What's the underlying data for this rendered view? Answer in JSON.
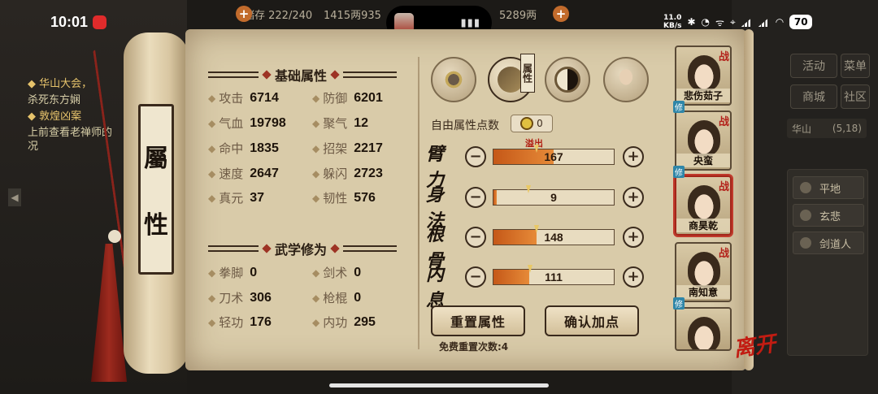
{
  "status_bar": {
    "time": "10:01",
    "net_speed": "11.0\nKB/s",
    "battery": "70"
  },
  "top_resources": {
    "storage": "储存 222/240",
    "silver": "1415两935",
    "gold": "5289两"
  },
  "quests": [
    {
      "text": "◆ 华山大会，",
      "highlight": true
    },
    {
      "text": "杀死东方娴",
      "highlight": false
    },
    {
      "text": "◆ 敦煌凶案",
      "highlight": true
    },
    {
      "text": "上前查看老禅师的",
      "highlight": false
    },
    {
      "text": "况",
      "highlight": false
    }
  ],
  "right_menu": {
    "activity": "活动",
    "menu": "菜单",
    "shop": "商城",
    "community": "社区",
    "location": "华山",
    "coords": "(5,18)"
  },
  "places": [
    "平地",
    "玄悲",
    "剑道人"
  ],
  "rod_title": [
    "屬",
    "性"
  ],
  "basic": {
    "title": "基础属性",
    "attrs": [
      {
        "label": "攻击",
        "value": "6714"
      },
      {
        "label": "防御",
        "value": "6201"
      },
      {
        "label": "气血",
        "value": "19798"
      },
      {
        "label": "聚气",
        "value": "12"
      },
      {
        "label": "命中",
        "value": "1835"
      },
      {
        "label": "招架",
        "value": "2217"
      },
      {
        "label": "速度",
        "value": "2647"
      },
      {
        "label": "躲闪",
        "value": "2723"
      },
      {
        "label": "真元",
        "value": "37"
      },
      {
        "label": "韧性",
        "value": "576"
      }
    ]
  },
  "martial": {
    "title": "武学修为",
    "attrs": [
      {
        "label": "拳脚",
        "value": "0"
      },
      {
        "label": "剑术",
        "value": "0"
      },
      {
        "label": "刀术",
        "value": "306"
      },
      {
        "label": "枪棍",
        "value": "0"
      },
      {
        "label": "轻功",
        "value": "176"
      },
      {
        "label": "内功",
        "value": "295"
      }
    ]
  },
  "tabs": {
    "active_tag": "属性",
    "icons": [
      "hero-portrait-icon",
      "attribute-book-icon",
      "bagua-icon",
      "meridian-body-icon"
    ]
  },
  "free_points": {
    "label": "自由属性点数",
    "value": "0"
  },
  "overflow_label": "溢出",
  "stats": [
    {
      "name": "臂力",
      "value": "167",
      "fill": 0.5
    },
    {
      "name": "身法",
      "value": "9",
      "fill": 0.03
    },
    {
      "name": "根骨",
      "value": "148",
      "fill": 0.36
    },
    {
      "name": "内息",
      "value": "111",
      "fill": 0.3
    }
  ],
  "buttons": {
    "reset": "重置属性",
    "confirm": "确认加点",
    "free_reset": "免费重置次数:4"
  },
  "roster": [
    {
      "name": "悲伤茹子",
      "zhan": "战",
      "active": false
    },
    {
      "name": "央蛮",
      "zhan": "战",
      "active": false
    },
    {
      "name": "商昊乾",
      "zhan": "战",
      "active": true
    },
    {
      "name": "南知意",
      "zhan": "战",
      "active": false
    },
    {
      "name": "",
      "zhan": "",
      "active": false
    }
  ],
  "roster_xiu": "修",
  "leave": "离开"
}
